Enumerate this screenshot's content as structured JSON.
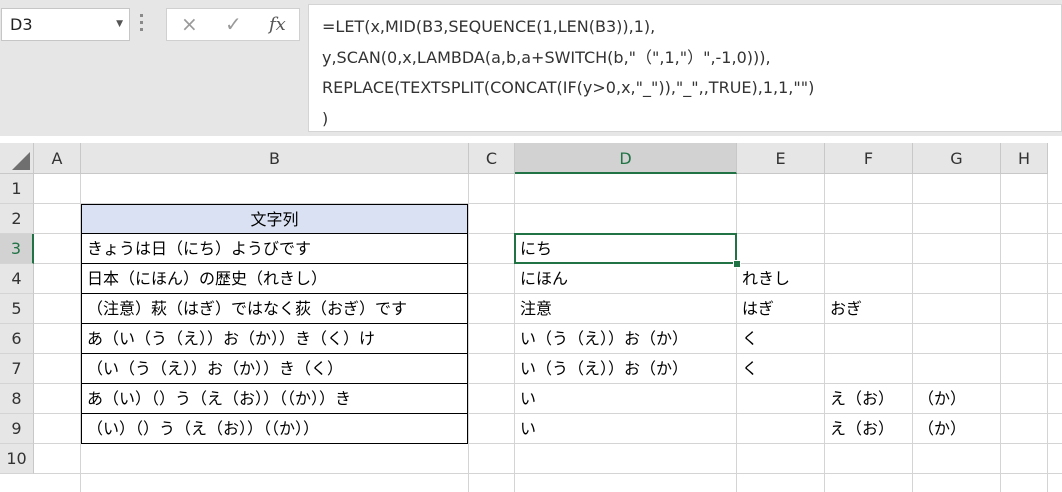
{
  "name_box": {
    "value": "D3"
  },
  "formula_bar": {
    "cancel_icon": "×",
    "enter_icon": "✓",
    "fx_label": "fx",
    "lines": [
      "=LET(x,MID(B3,SEQUENCE(1,LEN(B3)),1),",
      "y,SCAN(0,x,LAMBDA(a,b,a+SWITCH(b,\"（\",1,\"）\",-1,0))),",
      "REPLACE(TEXTSPLIT(CONCAT(IF(y>0,x,\"_\")),\"_\",,TRUE),1,1,\"\")",
      ")"
    ]
  },
  "columns": [
    "A",
    "B",
    "C",
    "D",
    "E",
    "F",
    "G",
    "H"
  ],
  "rows": [
    "1",
    "2",
    "3",
    "4",
    "5",
    "6",
    "7",
    "8",
    "9",
    "10"
  ],
  "selected_column": "D",
  "selected_row": "3",
  "cells": {
    "B2": "文字列",
    "B3": "きょうは日（にち）ようびです",
    "B4": "日本（にほん）の歴史（れきし）",
    "B5": "（注意）萩（はぎ）ではなく荻（おぎ）です",
    "B6": "あ（い（う（え））お（か））き（く）け",
    "B7": "（い（う（え））お（か））き（く）",
    "B8": "あ（い）（）う（え（お））（（か））き",
    "B9": "（い）（）う（え（お））（（か））",
    "D3": "にち",
    "D4": "にほん",
    "E4": "れきし",
    "D5": "注意",
    "E5": "はぎ",
    "F5": "おぎ",
    "D6": "い（う（え））お（か）",
    "E6": "く",
    "D7": "い（う（え））お（か）",
    "E7": "く",
    "D8": "い",
    "F8": "え（お）",
    "G8": "（か）",
    "D9": "い",
    "F9": "え（お）",
    "G9": "（か）"
  },
  "colors": {
    "accent": "#217346",
    "header_fill": "#d9e1f2"
  }
}
